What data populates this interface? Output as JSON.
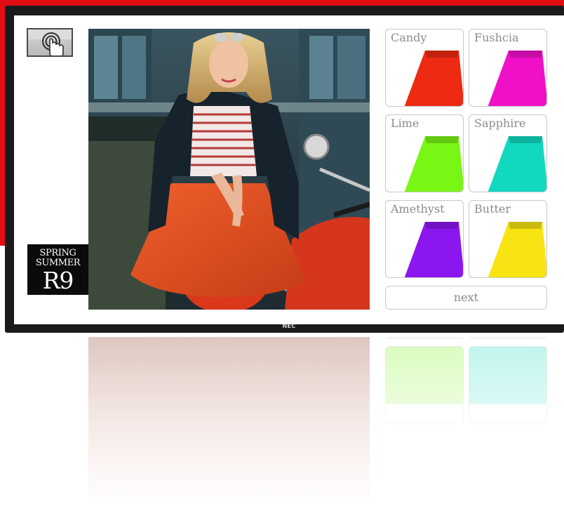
{
  "display": {
    "brand": "NEC"
  },
  "season_badge": {
    "line1": "SPRING",
    "line2": "SUMMER",
    "line3": "R9"
  },
  "touch_prompt": {
    "icon": "touch-hand-icon"
  },
  "hero": {
    "icon": "model-photo"
  },
  "swatches": [
    {
      "label": "Candy",
      "color": "#ee2a12"
    },
    {
      "label": "Fushcia",
      "color": "#ef10c8"
    },
    {
      "label": "Lime",
      "color": "#7af614"
    },
    {
      "label": "Sapphire",
      "color": "#12d8c0"
    },
    {
      "label": "Amethyst",
      "color": "#8b16f0"
    },
    {
      "label": "Butter",
      "color": "#f7e412"
    }
  ],
  "next_button": {
    "label": "next"
  },
  "colors": {
    "accent_red": "#e10f13",
    "bezel": "#1b1b1d"
  }
}
